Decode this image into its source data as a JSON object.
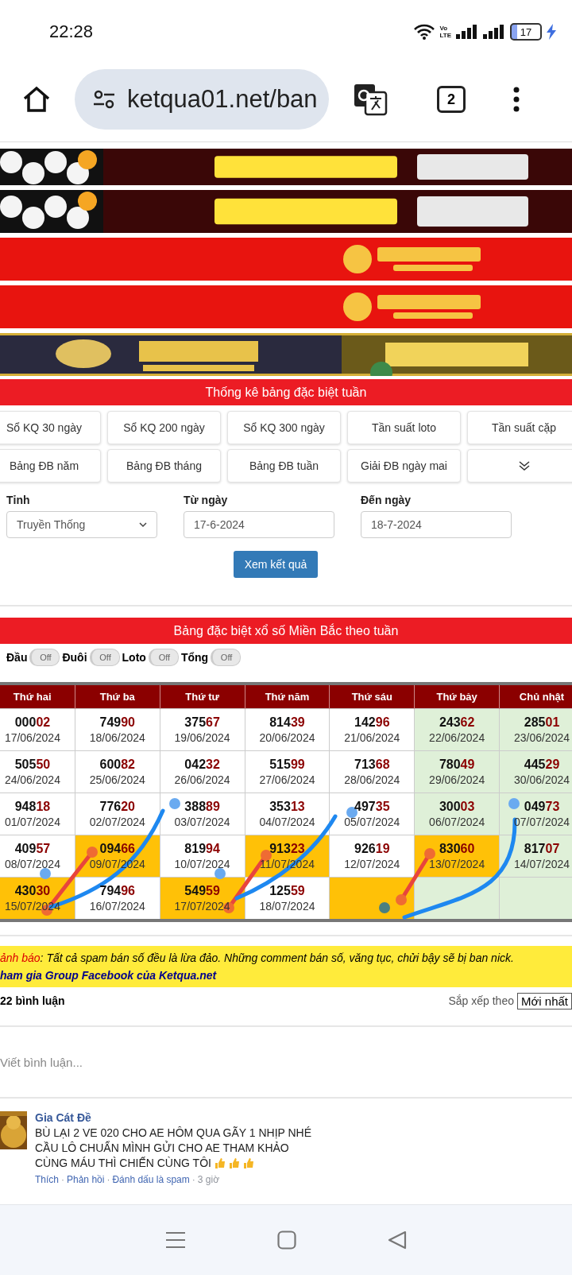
{
  "status_bar": {
    "time": "22:28",
    "volte_top": "Vo",
    "volte_bottom": "LTE",
    "battery": "17"
  },
  "browser": {
    "url": "ketqua01.net/ban",
    "tab_count": "2"
  },
  "stats_section": {
    "title": "Thống kê bảng đặc biệt tuần",
    "links": [
      {
        "label": "Sổ KQ 30 ngày"
      },
      {
        "label": "Sổ KQ 200 ngày"
      },
      {
        "label": "Sổ KQ 300 ngày"
      },
      {
        "label": "Tần suất loto"
      },
      {
        "label": "Tần suất cặp"
      },
      {
        "label": "Bảng ĐB năm"
      },
      {
        "label": "Bảng ĐB tháng"
      },
      {
        "label": "Bảng ĐB tuần"
      },
      {
        "label": "Giải ĐB ngày mai"
      },
      {
        "kind": "expand"
      }
    ]
  },
  "filter": {
    "province_label": "Tỉnh",
    "province": "Truyền Thống",
    "from_label": "Từ ngày",
    "from": "17-6-2024",
    "to_label": "Đến ngày",
    "to": "18-7-2024",
    "submit": "Xem kết quả"
  },
  "table_section": {
    "title": "Bảng đặc biệt xổ số Miền Bắc theo tuần",
    "toggles": [
      {
        "label": "Đầu",
        "state": "Off",
        "on": false
      },
      {
        "label": "Đuôi",
        "state": "Off",
        "on": false
      },
      {
        "label": "Loto",
        "state": "Off",
        "on": false
      },
      {
        "label": "Tổng",
        "state": "Off",
        "on": false
      }
    ],
    "columns": [
      {
        "label": "Thứ hai",
        "weekend": false
      },
      {
        "label": "Thứ ba",
        "weekend": false
      },
      {
        "label": "Thứ tư",
        "weekend": false
      },
      {
        "label": "Thứ năm",
        "weekend": false
      },
      {
        "label": "Thứ sáu",
        "weekend": false
      },
      {
        "label": "Thứ bảy",
        "weekend": true
      },
      {
        "label": "Chủ nhật",
        "weekend": true
      }
    ],
    "rows": [
      [
        {
          "head": "000",
          "tail": "02",
          "date": "17/06/2024",
          "highlighted": false
        },
        {
          "head": "749",
          "tail": "90",
          "date": "18/06/2024",
          "highlighted": false
        },
        {
          "head": "375",
          "tail": "67",
          "date": "19/06/2024",
          "highlighted": false
        },
        {
          "head": "814",
          "tail": "39",
          "date": "20/06/2024",
          "highlighted": false
        },
        {
          "head": "142",
          "tail": "96",
          "date": "21/06/2024",
          "highlighted": false
        },
        {
          "head": "243",
          "tail": "62",
          "date": "22/06/2024",
          "highlighted": false
        },
        {
          "head": "285",
          "tail": "01",
          "date": "23/06/2024",
          "highlighted": false
        }
      ],
      [
        {
          "head": "505",
          "tail": "50",
          "date": "24/06/2024",
          "highlighted": false
        },
        {
          "head": "600",
          "tail": "82",
          "date": "25/06/2024",
          "highlighted": false
        },
        {
          "head": "042",
          "tail": "32",
          "date": "26/06/2024",
          "highlighted": false
        },
        {
          "head": "515",
          "tail": "99",
          "date": "27/06/2024",
          "highlighted": false
        },
        {
          "head": "713",
          "tail": "68",
          "date": "28/06/2024",
          "highlighted": false
        },
        {
          "head": "780",
          "tail": "49",
          "date": "29/06/2024",
          "highlighted": false
        },
        {
          "head": "445",
          "tail": "29",
          "date": "30/06/2024",
          "highlighted": false
        }
      ],
      [
        {
          "head": "948",
          "tail": "18",
          "date": "01/07/2024",
          "highlighted": false
        },
        {
          "head": "776",
          "tail": "20",
          "date": "02/07/2024",
          "highlighted": false
        },
        {
          "head": "388",
          "tail": "89",
          "date": "03/07/2024",
          "highlighted": false
        },
        {
          "head": "353",
          "tail": "13",
          "date": "04/07/2024",
          "highlighted": false
        },
        {
          "head": "497",
          "tail": "35",
          "date": "05/07/2024",
          "highlighted": false
        },
        {
          "head": "300",
          "tail": "03",
          "date": "06/07/2024",
          "highlighted": false
        },
        {
          "head": "049",
          "tail": "73",
          "date": "07/07/2024",
          "highlighted": false
        }
      ],
      [
        {
          "head": "409",
          "tail": "57",
          "date": "08/07/2024",
          "highlighted": false
        },
        {
          "head": "094",
          "tail": "66",
          "date": "09/07/2024",
          "highlighted": true
        },
        {
          "head": "819",
          "tail": "94",
          "date": "10/07/2024",
          "highlighted": false
        },
        {
          "head": "913",
          "tail": "23",
          "date": "11/07/2024",
          "highlighted": true
        },
        {
          "head": "926",
          "tail": "19",
          "date": "12/07/2024",
          "highlighted": false
        },
        {
          "head": "830",
          "tail": "60",
          "date": "13/07/2024",
          "highlighted": true
        },
        {
          "head": "817",
          "tail": "07",
          "date": "14/07/2024",
          "highlighted": false
        }
      ],
      [
        {
          "head": "430",
          "tail": "30",
          "date": "15/07/2024",
          "highlighted": true
        },
        {
          "head": "794",
          "tail": "96",
          "date": "16/07/2024",
          "highlighted": false
        },
        {
          "head": "549",
          "tail": "59",
          "date": "17/07/2024",
          "highlighted": true
        },
        {
          "head": "125",
          "tail": "59",
          "date": "18/07/2024",
          "highlighted": false
        },
        {
          "highlighted": true
        },
        {
          "highlighted": false
        },
        {
          "highlighted": false
        }
      ]
    ]
  },
  "comments": {
    "warning_label": "ảnh báo",
    "warning_text": ": Tất cả spam bán số đều là lừa đảo. Những comment bán số, văng tục, chửi bậy sẽ bị ban nick.",
    "group_link": "ham gia Group Facebook của Ketqua.net",
    "count": "22 bình luận",
    "sort_label": "Sắp xếp theo",
    "sort_value": "Mới nhất",
    "input_placeholder": "Viết bình luận...",
    "items": [
      {
        "author": "Gia Cát Đề",
        "lines": [
          "BÙ LẠI 2 VE 020 CHO AE HÔM QUA GÃY 1 NHỊP NHÉ",
          "CẦU LÔ CHUẨN MÌNH GỬI CHO AE THAM KHẢO",
          "CÙNG MÁU THÌ CHIẾN CÙNG TÔI"
        ],
        "reactions": [
          {
            "kind": "thumbs_up"
          },
          {
            "kind": "thumbs_up"
          },
          {
            "kind": "thumbs_up"
          }
        ],
        "separator": "·",
        "actions": [
          {
            "label": "Thích",
            "kind": "link"
          },
          {
            "label": "Phản hồi",
            "kind": "link"
          },
          {
            "label": "Đánh dấu là spam",
            "kind": "link"
          },
          {
            "label": "3 giờ",
            "kind": "time"
          }
        ]
      }
    ]
  }
}
